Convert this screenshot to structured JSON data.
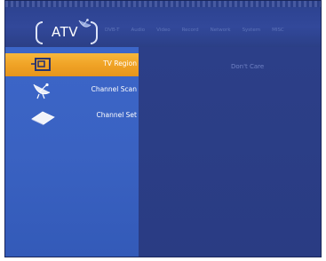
{
  "header": {
    "active_tab": "ATV",
    "tabs": [
      "DVB-T",
      "Audio",
      "Video",
      "Record",
      "Network",
      "System",
      "MISC"
    ]
  },
  "sidebar": {
    "items": [
      {
        "label": "TV Region",
        "icon": "tv-region-icon",
        "selected": true
      },
      {
        "label": "Channel Scan",
        "icon": "satellite-dish-icon",
        "selected": false
      },
      {
        "label": "Channel Set",
        "icon": "channel-set-icon",
        "selected": false
      }
    ]
  },
  "main": {
    "value": "Don't Care"
  },
  "colors": {
    "background": "#2b3f86",
    "sidebar": "#3a62c2",
    "selected": "#f0a326",
    "text": "#ffffff"
  }
}
